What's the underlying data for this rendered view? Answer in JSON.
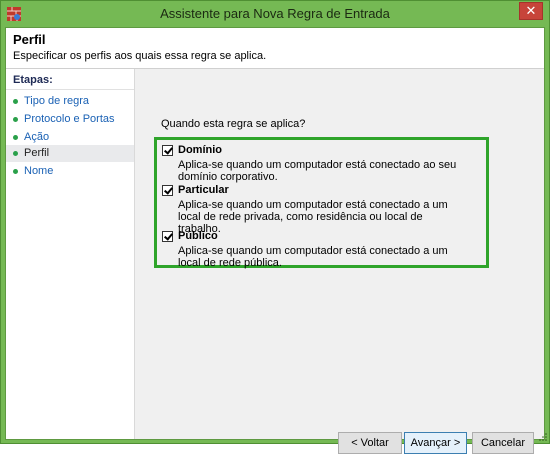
{
  "window": {
    "title": "Assistente para Nova Regra de Entrada",
    "close_glyph": "✕"
  },
  "header": {
    "title": "Perfil",
    "subtitle": "Especificar os perfis aos quais essa regra se aplica."
  },
  "sidebar": {
    "label": "Etapas:",
    "steps": [
      {
        "label": "Tipo de regra"
      },
      {
        "label": "Protocolo e Portas"
      },
      {
        "label": "Ação"
      },
      {
        "label": "Perfil",
        "current": true
      },
      {
        "label": "Nome"
      }
    ]
  },
  "main": {
    "question": "Quando esta regra se aplica?",
    "options": [
      {
        "title": "Domínio",
        "checked": true,
        "description": "Aplica-se quando um computador está conectado ao seu domínio corporativo."
      },
      {
        "title": "Particular",
        "checked": true,
        "description": "Aplica-se quando um computador está conectado a um local de rede privada, como residência ou local de trabalho."
      },
      {
        "title": "Público",
        "checked": true,
        "description": "Aplica-se quando um computador está conectado a um local de rede pública."
      }
    ]
  },
  "buttons": {
    "back": "< Voltar",
    "next": "Avançar >",
    "cancel": "Cancelar"
  },
  "colors": {
    "frame": "#75b954",
    "highlight": "#2ea42a",
    "link": "#1a61b4",
    "close": "#c7443a"
  },
  "icons": {
    "app": "firewall-icon",
    "close": "close-icon",
    "step_bullet": "bullet-dot-icon",
    "check": "checkmark-icon"
  }
}
